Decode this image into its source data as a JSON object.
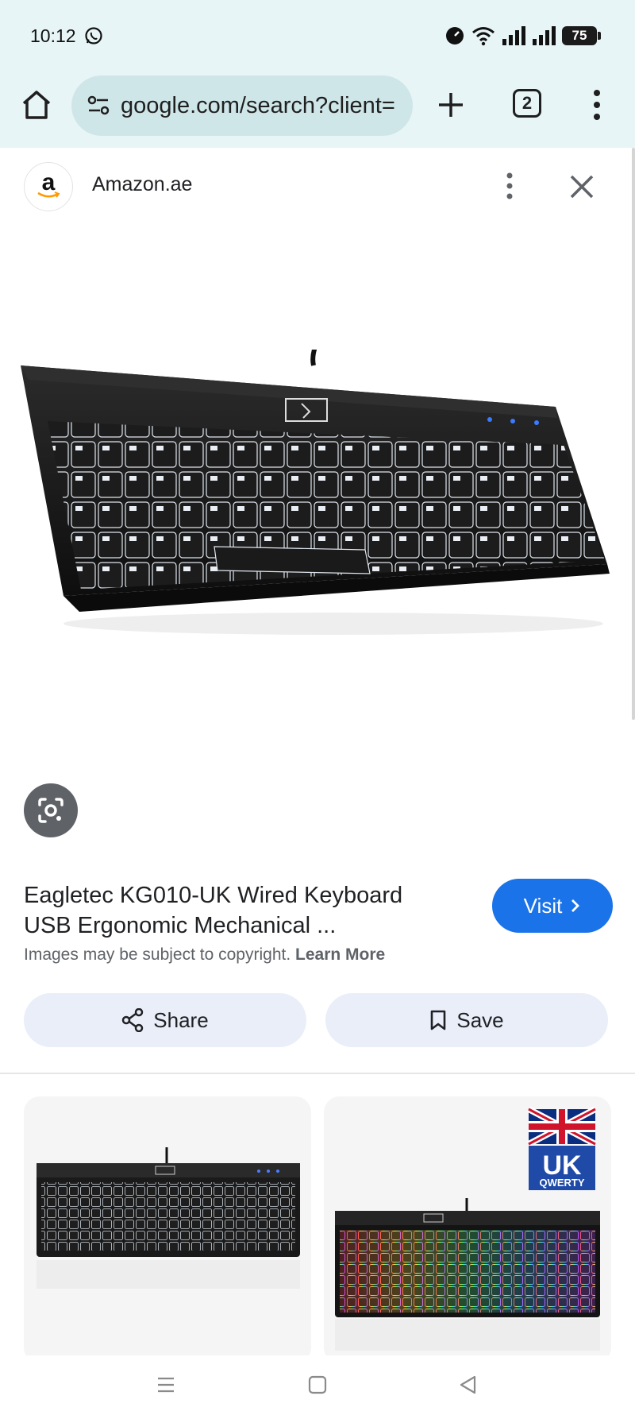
{
  "status_bar": {
    "time": "10:12",
    "battery": "75"
  },
  "browser": {
    "url": "google.com/search?client=",
    "tab_count": "2"
  },
  "source": {
    "logo_letter": "a",
    "name": "Amazon.ae"
  },
  "product": {
    "title_line1": "Eagletec KG010-UK Wired Keyboard",
    "title_line2": "USB Ergonomic Mechanical ...",
    "visit_label": "Visit",
    "copyright_text": "Images may be subject to copyright.",
    "learn_more": "Learn More"
  },
  "actions": {
    "share_label": "Share",
    "save_label": "Save"
  },
  "related": {
    "badge_top": "UK",
    "badge_bottom": "QWERTY"
  },
  "colors": {
    "accent": "#1a73e8",
    "toolbar_bg": "#e8f5f7",
    "action_bg": "#e9eef9"
  },
  "icons": [
    "whatsapp-icon",
    "wifi-icon",
    "signal-icon",
    "battery-icon",
    "home-icon",
    "site-settings-icon",
    "plus-icon",
    "tab-switcher-icon",
    "more-vert-icon",
    "close-icon",
    "lens-icon",
    "chevron-right-icon",
    "share-icon",
    "bookmark-icon",
    "nav-menu-icon",
    "nav-home-icon",
    "nav-back-icon"
  ]
}
